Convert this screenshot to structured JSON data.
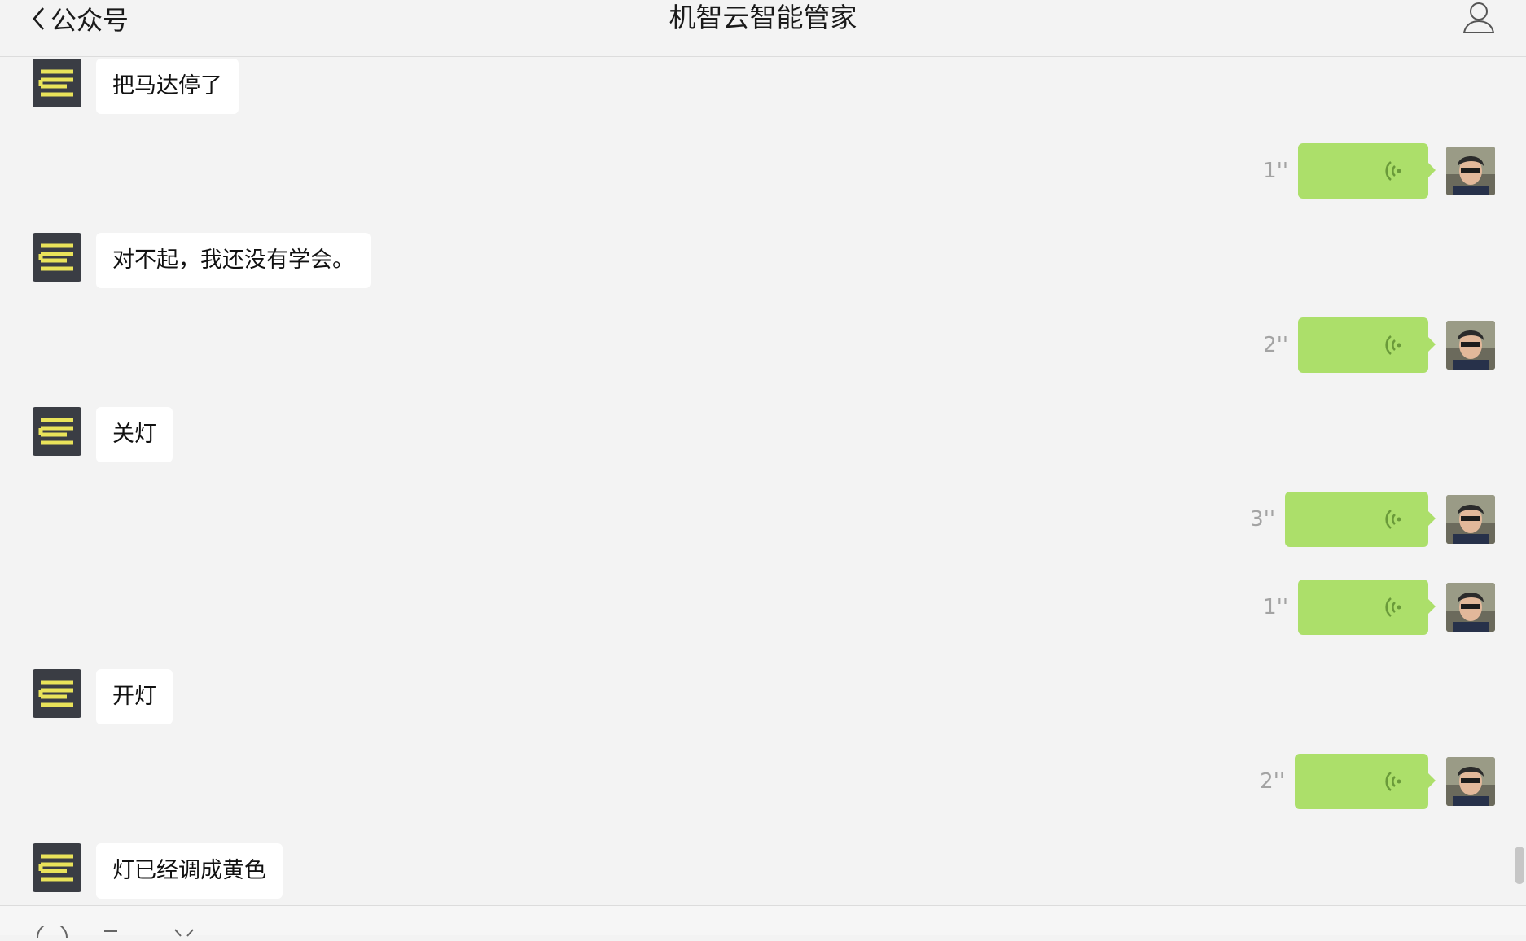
{
  "header": {
    "back_label": "公众号",
    "title": "机智云智能管家"
  },
  "icons": {
    "back": "chevron-left-icon",
    "profile": "person-outline-icon",
    "voice": "voice-wave-icon",
    "bot_avatar": "gizwits-logo",
    "user_avatar": "user-photo-avatar"
  },
  "colors": {
    "background": "#f3f3f3",
    "bot_bubble": "#ffffff",
    "user_bubble": "#acdf6a",
    "voice_wave": "#6a9a3a",
    "duration_text": "#a3a3a3",
    "bot_logo_bg": "#3a3d44",
    "bot_logo_fg": "#e9e35a"
  },
  "messages": [
    {
      "sender": "bot",
      "text": "把马达停了"
    },
    {
      "sender": "user",
      "type": "voice",
      "duration": "1''"
    },
    {
      "sender": "bot",
      "text": "对不起，我还没有学会。"
    },
    {
      "sender": "user",
      "type": "voice",
      "duration": "2''"
    },
    {
      "sender": "bot",
      "text": "关灯"
    },
    {
      "sender": "user",
      "type": "voice",
      "duration": "3''"
    },
    {
      "sender": "user",
      "type": "voice",
      "duration": "1''"
    },
    {
      "sender": "bot",
      "text": "开灯"
    },
    {
      "sender": "user",
      "type": "voice",
      "duration": "2''"
    },
    {
      "sender": "bot",
      "text": "灯已经调成黄色"
    }
  ]
}
